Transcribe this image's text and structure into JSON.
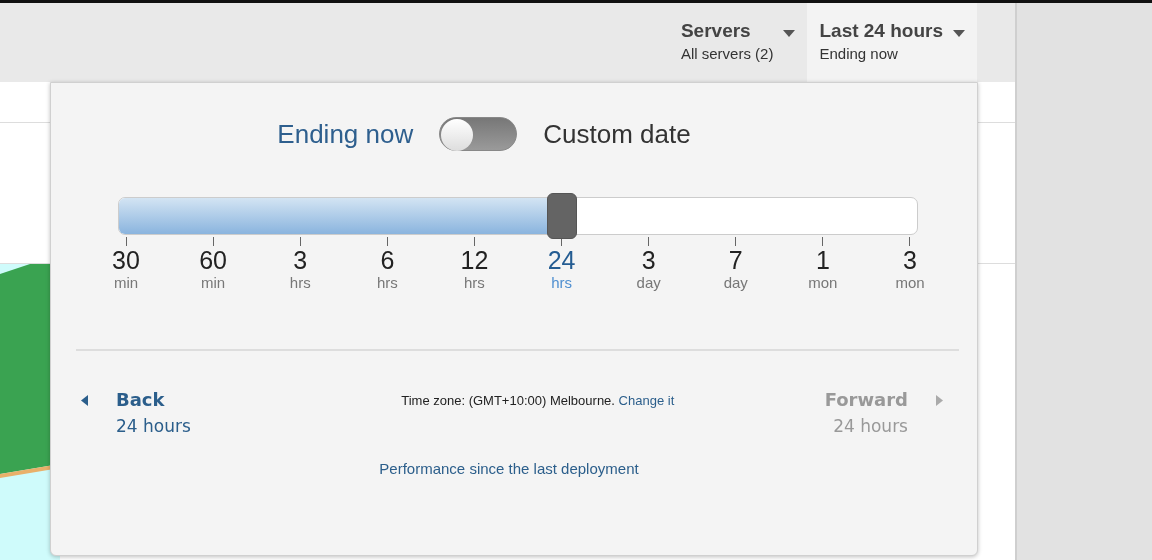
{
  "header": {
    "servers": {
      "title": "Servers",
      "subtitle": "All servers (2)"
    },
    "time_range": {
      "title": "Last 24 hours",
      "subtitle": "Ending now",
      "expanded": true
    }
  },
  "popup": {
    "toggle": {
      "left_label": "Ending now",
      "right_label": "Custom date",
      "on": false
    },
    "slider": {
      "level": 0.555,
      "ticks": [
        {
          "value": "30",
          "unit": "min",
          "selected": false
        },
        {
          "value": "60",
          "unit": "min",
          "selected": false
        },
        {
          "value": "3",
          "unit": "hrs",
          "selected": false
        },
        {
          "value": "6",
          "unit": "hrs",
          "selected": false
        },
        {
          "value": "12",
          "unit": "hrs",
          "selected": false
        },
        {
          "value": "24",
          "unit": "hrs",
          "selected": true
        },
        {
          "value": "3",
          "unit": "day",
          "selected": false
        },
        {
          "value": "7",
          "unit": "day",
          "selected": false
        },
        {
          "value": "1",
          "unit": "mon",
          "selected": false
        },
        {
          "value": "3",
          "unit": "mon",
          "selected": false
        }
      ]
    },
    "back": {
      "title": "Back",
      "subtitle": "24 hours",
      "disabled": false
    },
    "timezone": {
      "text": "Time zone: (GMT+10:00) Melbourne.",
      "link": "Change it"
    },
    "forward": {
      "title": "Forward",
      "subtitle": "24 hours",
      "disabled": true
    },
    "deployment_link": "Performance since the last deployment"
  }
}
